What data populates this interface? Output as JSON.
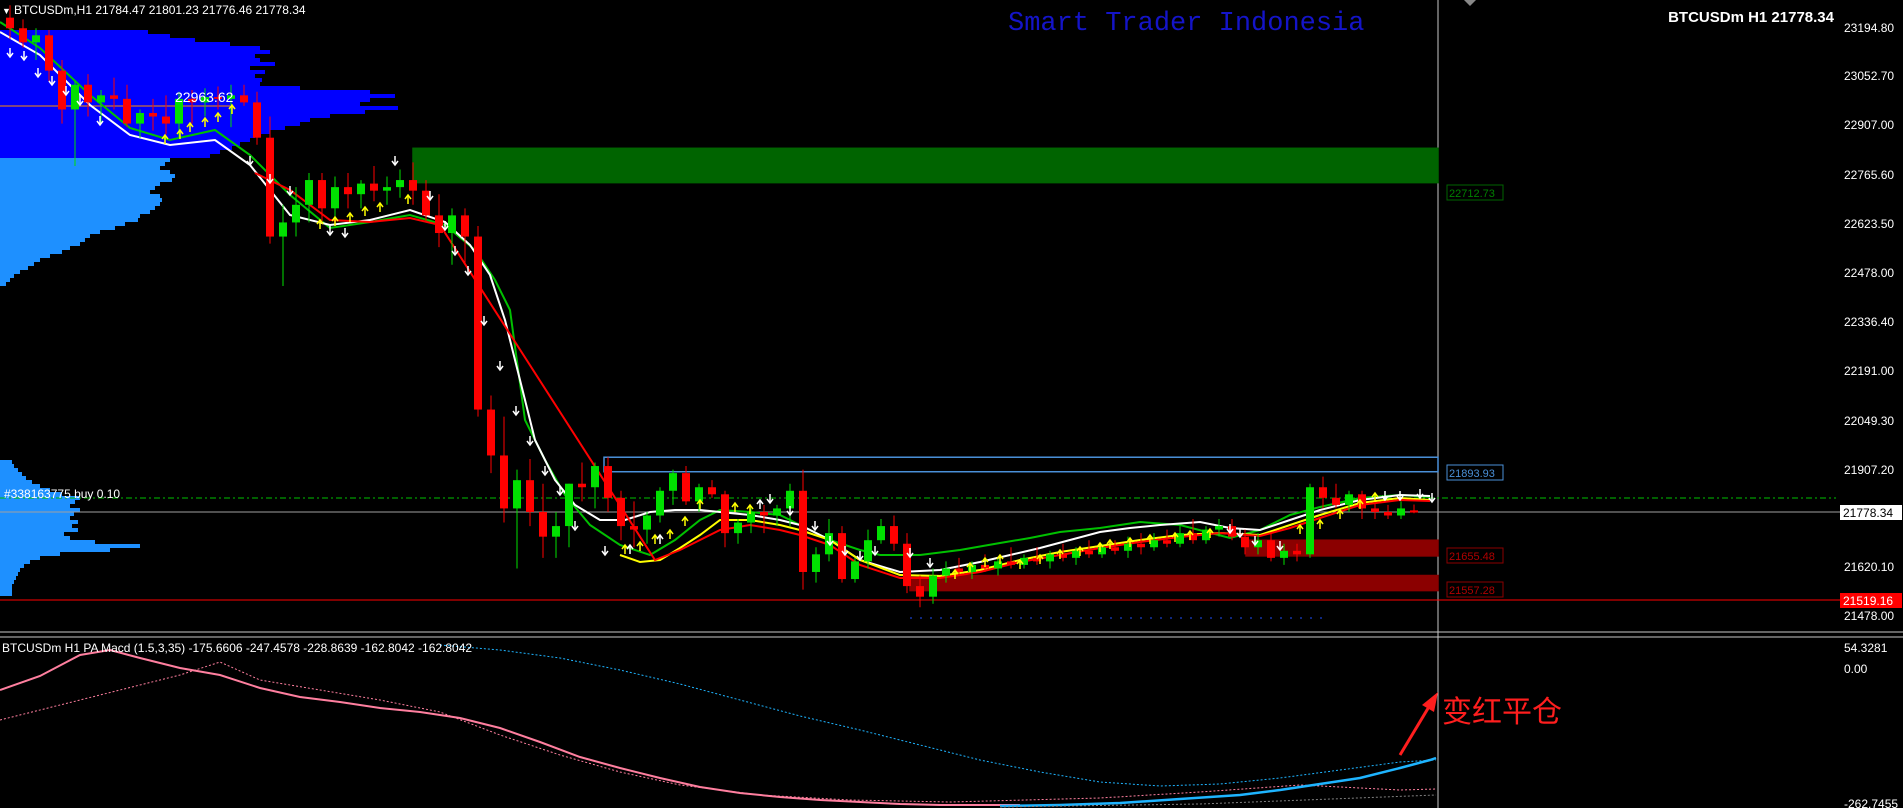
{
  "header": {
    "symbol_line": "BTCUSDm,H1  21784.47 21801.23 21776.46 21778.34",
    "watermark": "Smart Trader Indonesia",
    "top_right": "BTCUSDm H1 21778.34"
  },
  "colors": {
    "background": "#000000",
    "bull": "#00e000",
    "bear": "#ff0000",
    "volume_profile": "#1e90ff",
    "volume_profile_poc": "#0000ff",
    "supply_zone": "#006400",
    "demand_zone": "#8b0000",
    "ma_white": "#ffffff",
    "ma_green": "#00c000",
    "ma_yellow": "#ffff00",
    "ma_red": "#ff0000",
    "macd_pink": "#ff7f9f",
    "macd_blue": "#1eb4ff",
    "annotation": "#ff1e1e",
    "axis_text": "#ffffff"
  },
  "price_axis": {
    "ticks": [
      "23194.80",
      "23052.70",
      "22907.00",
      "22765.60",
      "22623.50",
      "22478.00",
      "22336.40",
      "22191.00",
      "22049.30",
      "21907.20",
      "21778.34",
      "21620.10",
      "21478.00"
    ],
    "current_price": "21778.34",
    "red_line_price": "21519.16"
  },
  "levels": {
    "poc_label": "22963.62",
    "supply_label": "22712.73",
    "range_high_label": "21893.93",
    "demand1_label": "21655.48",
    "demand2_label": "21557.28",
    "order_label": "#338163775 buy 0.10"
  },
  "macd_panel": {
    "title": "BTCUSDm H1 PA Macd (1.5,3,35) -175.6606 -247.4578 -228.8639 -162.8042 -162.8042",
    "axis_top": "54.3281",
    "axis_zero": "0.00",
    "axis_bottom": "-262.7455",
    "annotation": "变红平仓"
  },
  "chart_data": {
    "type": "candlestick",
    "symbol": "BTCUSDm",
    "timeframe": "H1",
    "ylim": [
      21440,
      23230
    ],
    "candles": [
      {
        "o": 23180,
        "h": 23215,
        "l": 23120,
        "c": 23150
      },
      {
        "o": 23150,
        "h": 23175,
        "l": 23095,
        "c": 23110
      },
      {
        "o": 23110,
        "h": 23150,
        "l": 23060,
        "c": 23130
      },
      {
        "o": 23130,
        "h": 23145,
        "l": 23000,
        "c": 23030
      },
      {
        "o": 23030,
        "h": 23060,
        "l": 22880,
        "c": 22920
      },
      {
        "o": 22920,
        "h": 23000,
        "l": 22760,
        "c": 22990
      },
      {
        "o": 22990,
        "h": 23020,
        "l": 22900,
        "c": 22940
      },
      {
        "o": 22940,
        "h": 22975,
        "l": 22880,
        "c": 22960
      },
      {
        "o": 22960,
        "h": 23010,
        "l": 22920,
        "c": 22950
      },
      {
        "o": 22950,
        "h": 22990,
        "l": 22870,
        "c": 22880
      },
      {
        "o": 22880,
        "h": 22920,
        "l": 22840,
        "c": 22910
      },
      {
        "o": 22910,
        "h": 22950,
        "l": 22860,
        "c": 22900
      },
      {
        "o": 22900,
        "h": 22960,
        "l": 22850,
        "c": 22880
      },
      {
        "o": 22880,
        "h": 22970,
        "l": 22840,
        "c": 22950
      },
      {
        "o": 22950,
        "h": 22975,
        "l": 22880,
        "c": 22940
      },
      {
        "o": 22940,
        "h": 22980,
        "l": 22900,
        "c": 22955
      },
      {
        "o": 22955,
        "h": 22985,
        "l": 22920,
        "c": 22950
      },
      {
        "o": 22950,
        "h": 22990,
        "l": 22870,
        "c": 22960
      },
      {
        "o": 22960,
        "h": 22990,
        "l": 22930,
        "c": 22940
      },
      {
        "o": 22940,
        "h": 22970,
        "l": 22820,
        "c": 22840
      },
      {
        "o": 22840,
        "h": 22900,
        "l": 22540,
        "c": 22560
      },
      {
        "o": 22560,
        "h": 22650,
        "l": 22420,
        "c": 22600
      },
      {
        "o": 22600,
        "h": 22700,
        "l": 22560,
        "c": 22650
      },
      {
        "o": 22650,
        "h": 22740,
        "l": 22600,
        "c": 22720
      },
      {
        "o": 22720,
        "h": 22740,
        "l": 22600,
        "c": 22640
      },
      {
        "o": 22640,
        "h": 22730,
        "l": 22610,
        "c": 22700
      },
      {
        "o": 22700,
        "h": 22740,
        "l": 22640,
        "c": 22680
      },
      {
        "o": 22680,
        "h": 22720,
        "l": 22640,
        "c": 22710
      },
      {
        "o": 22710,
        "h": 22760,
        "l": 22660,
        "c": 22690
      },
      {
        "o": 22690,
        "h": 22730,
        "l": 22650,
        "c": 22700
      },
      {
        "o": 22700,
        "h": 22750,
        "l": 22670,
        "c": 22720
      },
      {
        "o": 22720,
        "h": 22770,
        "l": 22650,
        "c": 22690
      },
      {
        "o": 22690,
        "h": 22720,
        "l": 22600,
        "c": 22620
      },
      {
        "o": 22620,
        "h": 22680,
        "l": 22530,
        "c": 22570
      },
      {
        "o": 22570,
        "h": 22640,
        "l": 22480,
        "c": 22620
      },
      {
        "o": 22620,
        "h": 22640,
        "l": 22480,
        "c": 22560
      },
      {
        "o": 22560,
        "h": 22590,
        "l": 22050,
        "c": 22070
      },
      {
        "o": 22070,
        "h": 22110,
        "l": 21890,
        "c": 21940
      },
      {
        "o": 21940,
        "h": 22050,
        "l": 21750,
        "c": 21790
      },
      {
        "o": 21790,
        "h": 21900,
        "l": 21620,
        "c": 21870
      },
      {
        "o": 21870,
        "h": 21930,
        "l": 21740,
        "c": 21780
      },
      {
        "o": 21780,
        "h": 21860,
        "l": 21650,
        "c": 21710
      },
      {
        "o": 21710,
        "h": 21780,
        "l": 21650,
        "c": 21740
      },
      {
        "o": 21740,
        "h": 21860,
        "l": 21680,
        "c": 21860
      },
      {
        "o": 21860,
        "h": 21920,
        "l": 21810,
        "c": 21850
      },
      {
        "o": 21850,
        "h": 21920,
        "l": 21790,
        "c": 21910
      },
      {
        "o": 21910,
        "h": 21935,
        "l": 21780,
        "c": 21820
      },
      {
        "o": 21820,
        "h": 21840,
        "l": 21700,
        "c": 21740
      },
      {
        "o": 21740,
        "h": 21810,
        "l": 21680,
        "c": 21730
      },
      {
        "o": 21730,
        "h": 21780,
        "l": 21690,
        "c": 21770
      },
      {
        "o": 21770,
        "h": 21850,
        "l": 21750,
        "c": 21840
      },
      {
        "o": 21840,
        "h": 21900,
        "l": 21800,
        "c": 21890
      },
      {
        "o": 21890,
        "h": 21910,
        "l": 21800,
        "c": 21810
      },
      {
        "o": 21810,
        "h": 21860,
        "l": 21780,
        "c": 21850
      },
      {
        "o": 21850,
        "h": 21870,
        "l": 21820,
        "c": 21830
      },
      {
        "o": 21830,
        "h": 21840,
        "l": 21680,
        "c": 21720
      },
      {
        "o": 21720,
        "h": 21760,
        "l": 21690,
        "c": 21750
      },
      {
        "o": 21750,
        "h": 21790,
        "l": 21720,
        "c": 21780
      },
      {
        "o": 21780,
        "h": 21800,
        "l": 21720,
        "c": 21770
      },
      {
        "o": 21770,
        "h": 21800,
        "l": 21740,
        "c": 21790
      },
      {
        "o": 21790,
        "h": 21860,
        "l": 21740,
        "c": 21840
      },
      {
        "o": 21840,
        "h": 21900,
        "l": 21560,
        "c": 21610
      },
      {
        "o": 21610,
        "h": 21680,
        "l": 21580,
        "c": 21660
      },
      {
        "o": 21660,
        "h": 21760,
        "l": 21640,
        "c": 21720
      },
      {
        "o": 21720,
        "h": 21740,
        "l": 21580,
        "c": 21590
      },
      {
        "o": 21590,
        "h": 21650,
        "l": 21580,
        "c": 21640
      },
      {
        "o": 21640,
        "h": 21730,
        "l": 21620,
        "c": 21700
      },
      {
        "o": 21700,
        "h": 21760,
        "l": 21690,
        "c": 21740
      },
      {
        "o": 21740,
        "h": 21770,
        "l": 21670,
        "c": 21690
      },
      {
        "o": 21690,
        "h": 21720,
        "l": 21550,
        "c": 21570
      },
      {
        "o": 21570,
        "h": 21600,
        "l": 21510,
        "c": 21540
      },
      {
        "o": 21540,
        "h": 21620,
        "l": 21520,
        "c": 21600
      },
      {
        "o": 21600,
        "h": 21640,
        "l": 21580,
        "c": 21620
      },
      {
        "o": 21620,
        "h": 21650,
        "l": 21600,
        "c": 21610
      },
      {
        "o": 21610,
        "h": 21640,
        "l": 21590,
        "c": 21630
      },
      {
        "o": 21630,
        "h": 21660,
        "l": 21610,
        "c": 21620
      },
      {
        "o": 21620,
        "h": 21650,
        "l": 21600,
        "c": 21640
      },
      {
        "o": 21640,
        "h": 21680,
        "l": 21620,
        "c": 21630
      },
      {
        "o": 21630,
        "h": 21660,
        "l": 21620,
        "c": 21650
      },
      {
        "o": 21650,
        "h": 21680,
        "l": 21630,
        "c": 21640
      },
      {
        "o": 21640,
        "h": 21670,
        "l": 21620,
        "c": 21660
      },
      {
        "o": 21660,
        "h": 21690,
        "l": 21640,
        "c": 21650
      },
      {
        "o": 21650,
        "h": 21680,
        "l": 21630,
        "c": 21670
      },
      {
        "o": 21670,
        "h": 21700,
        "l": 21650,
        "c": 21660
      },
      {
        "o": 21660,
        "h": 21690,
        "l": 21650,
        "c": 21680
      },
      {
        "o": 21680,
        "h": 21700,
        "l": 21660,
        "c": 21670
      },
      {
        "o": 21670,
        "h": 21710,
        "l": 21650,
        "c": 21690
      },
      {
        "o": 21690,
        "h": 21720,
        "l": 21660,
        "c": 21680
      },
      {
        "o": 21680,
        "h": 21720,
        "l": 21670,
        "c": 21700
      },
      {
        "o": 21700,
        "h": 21730,
        "l": 21680,
        "c": 21690
      },
      {
        "o": 21690,
        "h": 21740,
        "l": 21680,
        "c": 21720
      },
      {
        "o": 21720,
        "h": 21760,
        "l": 21690,
        "c": 21700
      },
      {
        "o": 21700,
        "h": 21740,
        "l": 21690,
        "c": 21730
      },
      {
        "o": 21730,
        "h": 21760,
        "l": 21710,
        "c": 21740
      },
      {
        "o": 21740,
        "h": 21760,
        "l": 21700,
        "c": 21710
      },
      {
        "o": 21710,
        "h": 21730,
        "l": 21660,
        "c": 21680
      },
      {
        "o": 21680,
        "h": 21720,
        "l": 21660,
        "c": 21700
      },
      {
        "o": 21700,
        "h": 21720,
        "l": 21640,
        "c": 21650
      },
      {
        "o": 21650,
        "h": 21690,
        "l": 21630,
        "c": 21670
      },
      {
        "o": 21670,
        "h": 21690,
        "l": 21640,
        "c": 21660
      },
      {
        "o": 21660,
        "h": 21860,
        "l": 21650,
        "c": 21850
      },
      {
        "o": 21850,
        "h": 21880,
        "l": 21790,
        "c": 21820
      },
      {
        "o": 21820,
        "h": 21860,
        "l": 21790,
        "c": 21800
      },
      {
        "o": 21800,
        "h": 21840,
        "l": 21780,
        "c": 21830
      },
      {
        "o": 21830,
        "h": 21840,
        "l": 21760,
        "c": 21790
      },
      {
        "o": 21790,
        "h": 21810,
        "l": 21760,
        "c": 21780
      },
      {
        "o": 21780,
        "h": 21800,
        "l": 21760,
        "c": 21770
      },
      {
        "o": 21770,
        "h": 21810,
        "l": 21760,
        "c": 21790
      },
      {
        "o": 21784.47,
        "h": 21801.23,
        "l": 21776.46,
        "c": 21778.34
      }
    ],
    "zones": [
      {
        "name": "supply",
        "top": 22810,
        "bottom": 22712.73
      },
      {
        "name": "range_high",
        "top": 21935,
        "bottom": 21893.93
      },
      {
        "name": "demand_1",
        "top": 21700,
        "bottom": 21655.48
      },
      {
        "name": "demand_2",
        "top": 21600,
        "bottom": 21557.28
      }
    ],
    "macd": {
      "ylim": [
        -262.7455,
        54.3281
      ],
      "values": [
        -175.6606,
        -247.4578,
        -228.8639,
        -162.8042,
        -162.8042
      ]
    }
  }
}
